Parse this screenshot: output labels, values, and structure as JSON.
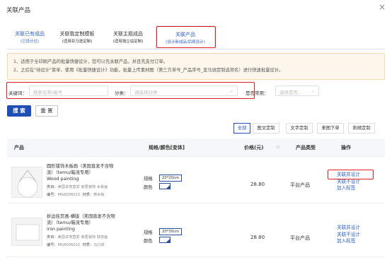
{
  "modal": {
    "title": "关联产品",
    "close_glyph": "×"
  },
  "tabs": [
    {
      "label": "关联已有成品",
      "sub": "(已设计过)"
    },
    {
      "label": "关联我定制模板",
      "sub": "(适用亚马逊定制)"
    },
    {
      "label": "关联主题成品",
      "sub": "(适用独立站定制)"
    },
    {
      "label": "关联产品",
      "sub": "(设计新成品/后续设计)"
    }
  ],
  "notice": {
    "line1": "1、适用于全印刷产品的批量快捷设计，您可以先关联产品，并且先支付订单。",
    "line2": "2、之后在\"待设计\"菜单，使用《批量快捷设计》功能，批量上传素材图（第三方单号_产品序号_亚马逊定制选项名）进行快速批量设计。"
  },
  "search": {
    "keyword_label": "关键词：",
    "keyword_placeholder": "搜索名称/编号",
    "category_label": "分类：",
    "category_placeholder": "请选择分类",
    "common_label": "是否常用：",
    "common_placeholder": "选择是否..."
  },
  "buttons": {
    "search": "搜 索",
    "reset": "重 置"
  },
  "filters": [
    "全部",
    "图文定制",
    "文字定制",
    "来图下单",
    "刺绣定制"
  ],
  "table": {
    "headers": {
      "product": "产品",
      "spec": "规格/颜色[变体]",
      "price": "价格(元)",
      "sort_glyph": "◇",
      "type": "产品类型",
      "ops": "操作"
    },
    "rows": [
      {
        "name_lines": [
          "圆形镂饰木板画（美国直发不含物",
          "流）（temu/箱流专用）",
          "Wood painting"
        ],
        "category_label": "类目：",
        "category": "美国本地直发 家居装饰 木板画",
        "code_label": "编号：",
        "code": "MG8006013",
        "material_label": "材质：",
        "material": "桦木板",
        "spec_label": "规格",
        "spec_value": "20*20cm",
        "color_label": "颜色",
        "price": "28.80",
        "type": "平台产品",
        "ops": [
          "关联并设计",
          "关联不设计",
          "加入标签"
        ]
      },
      {
        "name_lines": [
          "折边挂页画-横版（美国直发不含物",
          "流）（temu/箱流专用）",
          "iron painting"
        ],
        "category_label": "类目：",
        "category": "美国本地直发 家居装饰 铁皮画",
        "code_label": "编号：",
        "code": "MG8006012",
        "material_label": "材质：",
        "material": "马口铁",
        "spec_label": "规格",
        "spec_value": "20*30cm",
        "color_label": "颜色",
        "price": "28.80",
        "type": "平台产品",
        "ops": [
          "关联并设计",
          "关联不设计",
          "加入标签"
        ]
      }
    ]
  }
}
